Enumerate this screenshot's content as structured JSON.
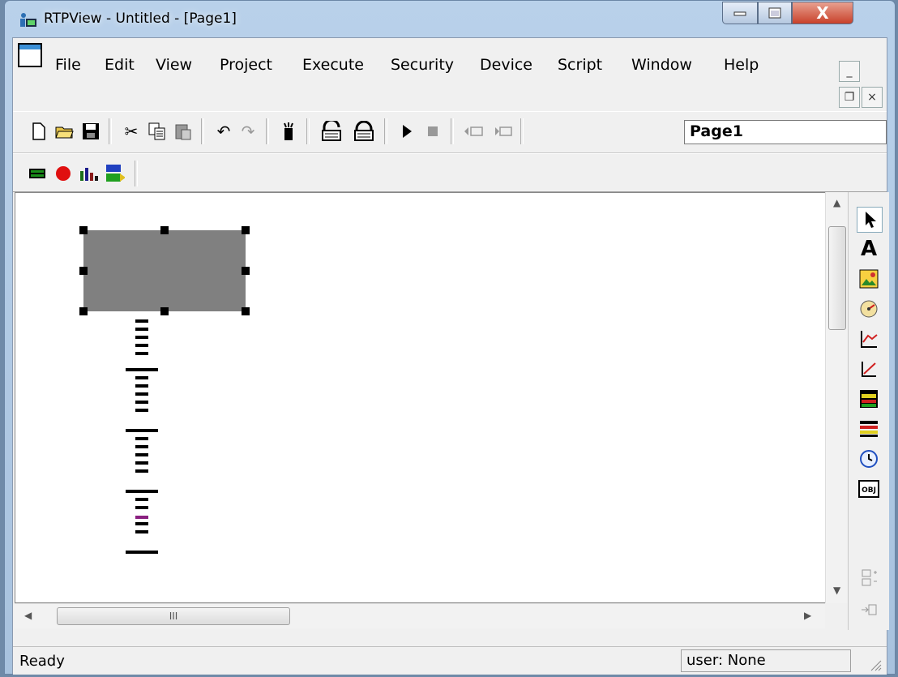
{
  "window": {
    "title": "RTPView  -  Untitled - [Page1]",
    "close_glyph": "X"
  },
  "menu": [
    "File",
    "Edit",
    "View",
    "Project",
    "Execute",
    "Security",
    "Device",
    "Script",
    "Window",
    "Help"
  ],
  "mdi_buttons": {
    "minimize": "_",
    "restore": "❐",
    "close": "×"
  },
  "toolbar": {
    "icons": [
      "new-file-icon",
      "open-folder-icon",
      "save-icon",
      "cut-icon",
      "copy-icon",
      "paste-icon",
      "undo-icon",
      "redo-icon",
      "properties-icon",
      "lock-icon",
      "unlock-icon",
      "play-icon",
      "stop-icon",
      "page-back-icon",
      "page-forward-icon"
    ],
    "page_combo": "Page1"
  },
  "toolbar2": {
    "icons": [
      "led-bar-icon",
      "record-icon",
      "chart-bars-icon",
      "rtp-fifo-icon"
    ]
  },
  "hscroll_grip": "III",
  "palette": {
    "icons": [
      "pointer-icon",
      "text-icon",
      "image-icon",
      "gauge-icon",
      "trend-chart-icon",
      "xy-plot-icon",
      "bar-indicator-icon",
      "table-icon",
      "clock-icon",
      "object-icon",
      "align-icon",
      "move-icon"
    ],
    "text_glyph": "A",
    "object_glyph": "OBJ"
  },
  "status": {
    "text": "Ready",
    "user": "user: None"
  }
}
